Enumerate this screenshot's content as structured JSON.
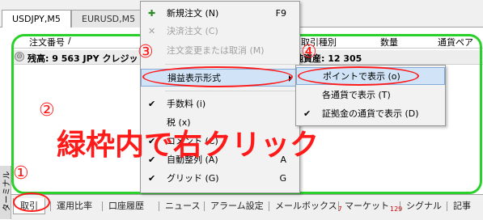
{
  "chart_tabs": [
    {
      "label": "USDJPY,M5"
    },
    {
      "label": "EURUSD,M5"
    }
  ],
  "terminal": {
    "vertical_title": "ターミナル",
    "columns": {
      "order": "注文番号",
      "sort_marker": "/",
      "type": "取引種別",
      "volume": "数量",
      "pair": "通貨ペア"
    },
    "balance_text": "残高: 9 563 JPY クレジット",
    "balance_right": "純資産: 12 305"
  },
  "bottom_tabs": [
    {
      "label": "取引"
    },
    {
      "label": "運用比率"
    },
    {
      "label": "口座履歴"
    },
    {
      "label": "ニュース"
    },
    {
      "label": "アラーム設定"
    },
    {
      "label": "メールボックス",
      "badge": "7"
    },
    {
      "label": "マーケット",
      "badge": "129"
    },
    {
      "label": "シグナル"
    },
    {
      "label": "記事"
    }
  ],
  "context_menu": {
    "items": [
      {
        "label": "新規注文 (N)",
        "shortcut": "F9",
        "icon": "new-order-icon"
      },
      {
        "label": "決済注文 (C)",
        "disabled": true
      },
      {
        "label": "注文変更または取消 (M)",
        "disabled": true
      },
      {
        "label": "損益表示形式",
        "submenu": true
      },
      {
        "label": "手数料 (i)",
        "checked": true
      },
      {
        "label": "税 (x)"
      },
      {
        "label": "コメント (C)",
        "checked": true
      },
      {
        "label": "自動整列 (A)",
        "shortcut": "A",
        "checked": true
      },
      {
        "label": "グリッド (G)",
        "shortcut": "G",
        "checked": true
      }
    ]
  },
  "submenu": {
    "items": [
      {
        "label": "ポイントで表示 (o)"
      },
      {
        "label": "各通貨で表示 (T)"
      },
      {
        "label": "証拠金の通貨で表示 (D)",
        "checked": true
      }
    ]
  },
  "annotations": {
    "n1": "①",
    "n2": "②",
    "n3": "③",
    "n4": "④",
    "instruction": "緑枠内で右クリック",
    "colors": {
      "highlight_box": "#2bd12b",
      "annotation": "#ff1a1a"
    }
  }
}
